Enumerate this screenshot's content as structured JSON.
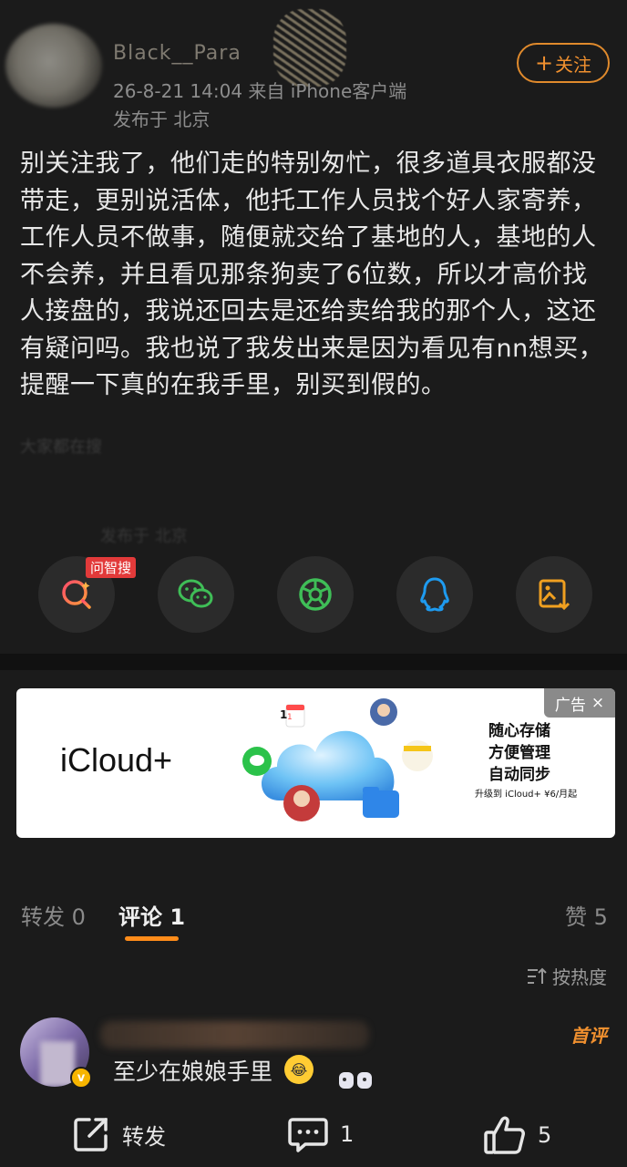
{
  "post": {
    "username": "Black__Para",
    "time_source": "26-8-21 14:04  来自 iPhone客户端",
    "location": "发布于 北京",
    "follow_label": "关注",
    "text": "别关注我了，他们走的特别匆忙，很多道具衣服都没带走，更别说活体，他托工作人员找个好人家寄养，工作人员不做事，随便就交给了基地的人，基地的人不会养，并且看见那条狗卖了6位数，所以才高价找人接盘的，我说还回去是还给卖给我的那个人，这还有疑问吗。我也说了我发出来是因为看见有nn想买，提醒一下真的在我手里，别买到假的。",
    "faded_line_1": "大家都在搜",
    "faded_line_2": "发布于 北京"
  },
  "share": {
    "badge_label": "问智搜",
    "items": [
      "ai-search-icon",
      "wechat-icon",
      "moments-icon",
      "qq-icon",
      "save-image-icon"
    ]
  },
  "ad": {
    "tag": "广告",
    "close": "×",
    "brand": "iCloud+",
    "lines": [
      "随心存储",
      "方便管理",
      "自动同步"
    ],
    "small": "升级到 iCloud+ ¥6/月起",
    "calendar_month": "1",
    "calendar_day": "1"
  },
  "tabs": {
    "repost": "转发 0",
    "comment": "评论 1",
    "like": "赞 5"
  },
  "sort_label": "按热度",
  "comment": {
    "text": "至少在娘娘手里",
    "first_badge": "首评",
    "v_badge": "v"
  },
  "bottom": {
    "repost_label": "转发",
    "comment_count": "1",
    "like_count": "5"
  },
  "colors": {
    "accent": "#f0902f",
    "background": "#1b1b1b",
    "badge_red": "#e23a3a"
  }
}
